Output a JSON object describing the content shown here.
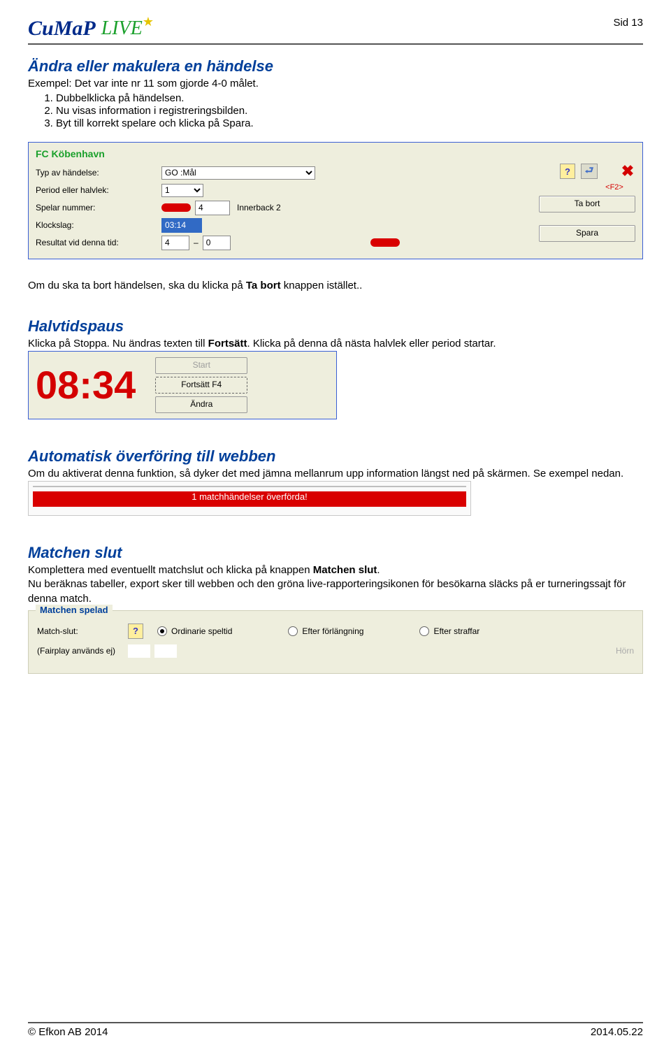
{
  "header": {
    "logo_main": "CuMaP",
    "logo_live": "LIVE",
    "page_label": "Sid 13"
  },
  "section1": {
    "heading": "Ändra eller makulera en händelse",
    "intro": "Exempel: Det var inte nr 11 som gjorde 4-0 målet.",
    "steps": {
      "s1": "Dubbelklicka på händelsen.",
      "s2": "Nu visas information i registreringsbilden.",
      "s3": "Byt till korrekt spelare och klicka på Spara."
    }
  },
  "dialog1": {
    "team": "FC Köbenhavn",
    "labels": {
      "type": "Typ av händelse:",
      "period": "Period eller halvlek:",
      "player": "Spelar nummer:",
      "clock": "Klockslag:",
      "score": "Resultat vid denna tid:"
    },
    "values": {
      "type": "GO :Mål",
      "period": "1",
      "player_no": "4",
      "player_pos": "Innerback 2",
      "clock": "03:14",
      "score_a": "4",
      "score_b": "0"
    },
    "buttons": {
      "f2": "<F2>",
      "remove": "Ta bort",
      "save": "Spara"
    }
  },
  "section1_after_pre": "Om du ska ta bort händelsen, ska du klicka på ",
  "section1_after_bold": "Ta bort",
  "section1_after_post": " knappen istället..",
  "section2": {
    "heading": "Halvtidspaus",
    "text_pre": "Klicka på Stoppa. Nu ändras texten till ",
    "text_bold": "Fortsätt",
    "text_post": ". Klicka på denna då nästa halvlek eller period startar."
  },
  "dialog2": {
    "time": "08:34",
    "buttons": {
      "start": "Start",
      "cont": "Fortsätt F4",
      "edit": "Ändra"
    }
  },
  "section3": {
    "heading": "Automatisk överföring till webben",
    "p1": "Om du aktiverat denna funktion, så dyker det med jämna mellanrum upp information längst ned på skärmen. Se exempel nedan."
  },
  "statusbar": "1 matchhändelser överförda!",
  "section4": {
    "heading": "Matchen slut",
    "p_pre": "Komplettera med eventuellt matchslut och klicka på knappen ",
    "p_bold": "Matchen slut",
    "p_post": ".",
    "p2": "Nu beräknas tabeller, export sker till webben och den gröna live-rapporteringsikonen för besökarna släcks på er turneringssajt för denna match."
  },
  "dialog3": {
    "legend": "Matchen spelad",
    "labels": {
      "end": "Match-slut:",
      "fairplay": "(Fairplay används ej)"
    },
    "radios": {
      "ord": "Ordinarie speltid",
      "ext": "Efter förlängning",
      "pen": "Efter straffar"
    },
    "horn": "Hörn"
  },
  "footer": {
    "left": "© Efkon AB 2014",
    "right": "2014.05.22"
  }
}
